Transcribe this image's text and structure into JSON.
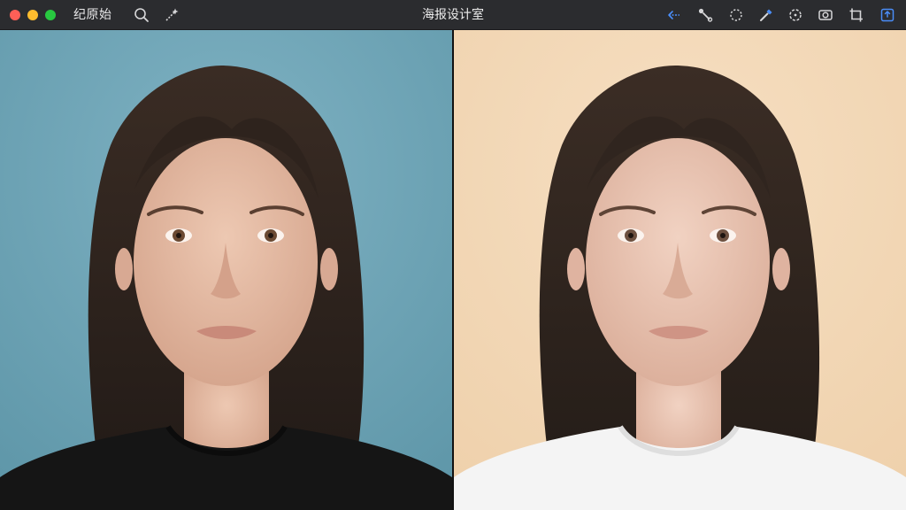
{
  "window": {
    "title": "海报设计室",
    "view_label": "纪原始"
  },
  "colors": {
    "close": "#ff5f57",
    "minimize": "#febc2e",
    "zoom": "#28c840",
    "accent": "#4a8df8",
    "icon": "#d6d6d8",
    "left_background": "#6ea6b8",
    "right_background": "#f3d9b8",
    "hair": "#2e2520",
    "skin": "#e3bca6",
    "shirt_dark": "#141414",
    "shirt_light": "#f4f4f4"
  },
  "toolbar": {
    "left_icons": [
      "search-icon",
      "magic-wand-icon"
    ],
    "right_icons": [
      "undo-icon",
      "brush-icon",
      "lasso-icon",
      "eyedropper-icon",
      "selection-icon",
      "mask-icon",
      "crop-icon",
      "export-icon"
    ]
  },
  "panels": {
    "left": {
      "description_name": "original-photo"
    },
    "right": {
      "description_name": "edited-photo"
    }
  }
}
